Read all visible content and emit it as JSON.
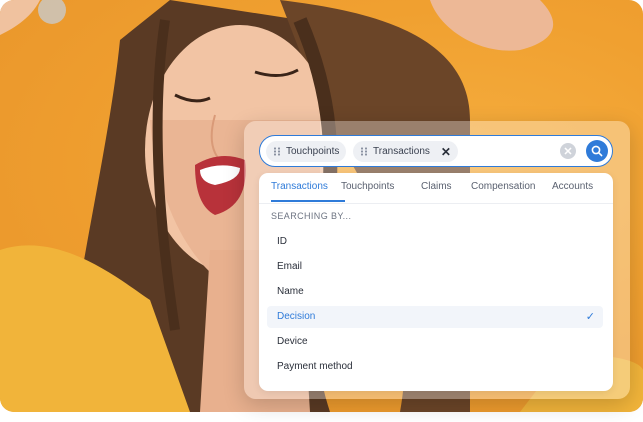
{
  "search": {
    "chips": [
      {
        "label": "Touchpoints",
        "removable": false
      },
      {
        "label": "Transactions",
        "removable": true
      }
    ],
    "clear_icon": "close-circle-icon",
    "search_icon": "search-icon"
  },
  "tabs": [
    {
      "label": "Transactions",
      "active": true
    },
    {
      "label": "Touchpoints",
      "active": false
    },
    {
      "label": "Claims",
      "active": false
    },
    {
      "label": "Compensation",
      "active": false
    },
    {
      "label": "Accounts",
      "active": false
    }
  ],
  "section_label": "SEARCHING BY...",
  "options": [
    {
      "label": "ID",
      "selected": false
    },
    {
      "label": "Email",
      "selected": false
    },
    {
      "label": "Name",
      "selected": false
    },
    {
      "label": "Decision",
      "selected": true
    },
    {
      "label": "Device",
      "selected": false
    },
    {
      "label": "Payment method",
      "selected": false
    }
  ],
  "colors": {
    "accent": "#2f7bd9",
    "background_photo": "#f0a030",
    "chip_bg": "#eef0f4"
  }
}
